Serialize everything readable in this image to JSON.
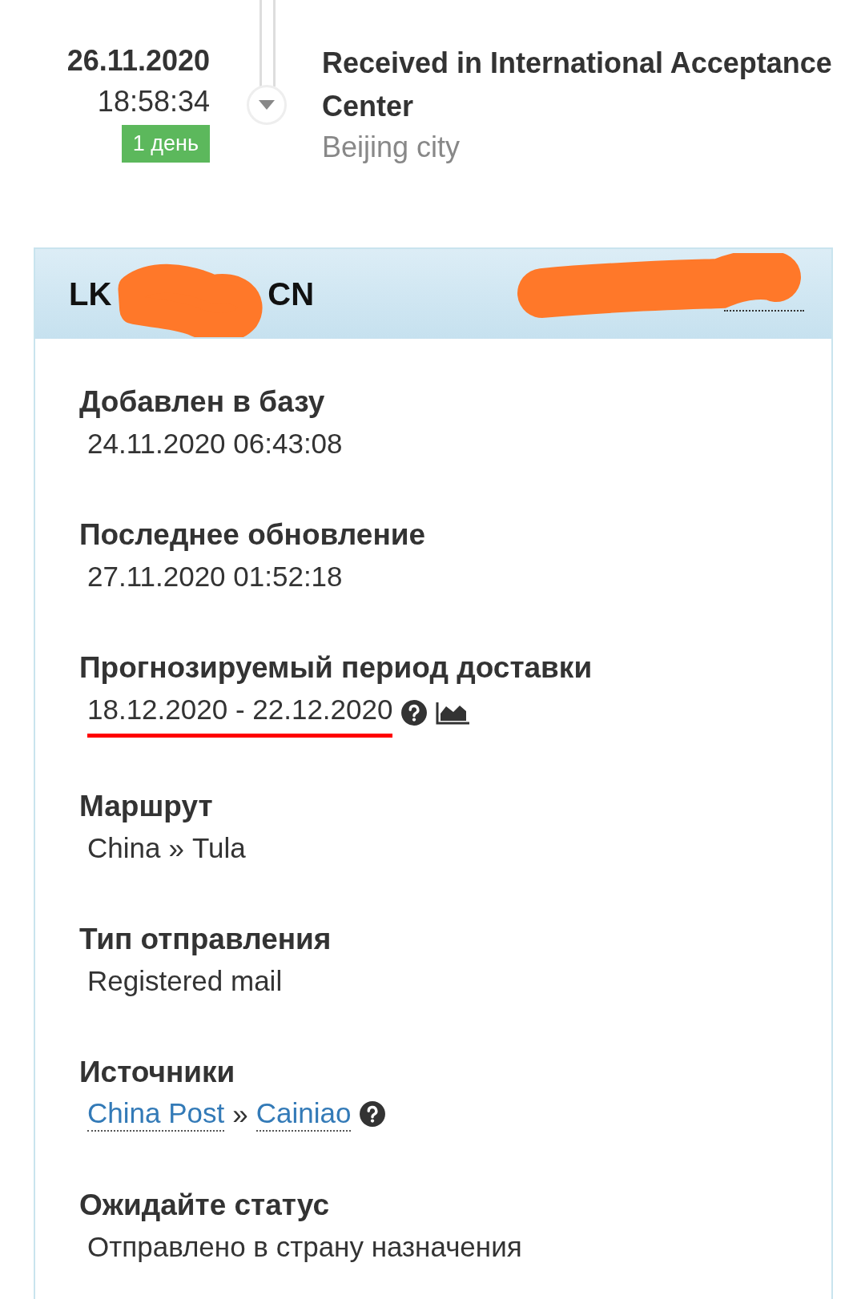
{
  "event": {
    "date": "26.11.2020",
    "time": "18:58:34",
    "badge": "1 день",
    "title": "Received in International Acceptance Center",
    "location": "Beijing city"
  },
  "card": {
    "tracking_start": "LK",
    "tracking_end": "CN",
    "fields": [
      {
        "kind": "text",
        "label": "Добавлен в базу",
        "value": "24.11.2020 06:43:08"
      },
      {
        "kind": "text",
        "label": "Последнее обновление",
        "value": "27.11.2020 01:52:18"
      },
      {
        "kind": "period",
        "label": "Прогнозируемый период доставки",
        "value": "18.12.2020 - 22.12.2020",
        "highlighted": true
      },
      {
        "kind": "route",
        "label": "Маршрут",
        "parts": [
          "China",
          "Tula"
        ],
        "separator": "»"
      },
      {
        "kind": "text",
        "label": "Тип отправления",
        "value": "Registered mail"
      },
      {
        "kind": "links",
        "label": "Источники",
        "parts": [
          "China Post",
          "Cainiao"
        ],
        "separator": "»"
      },
      {
        "kind": "text",
        "label": "Ожидайте статус",
        "value": "Отправлено в страну назначения"
      }
    ]
  }
}
